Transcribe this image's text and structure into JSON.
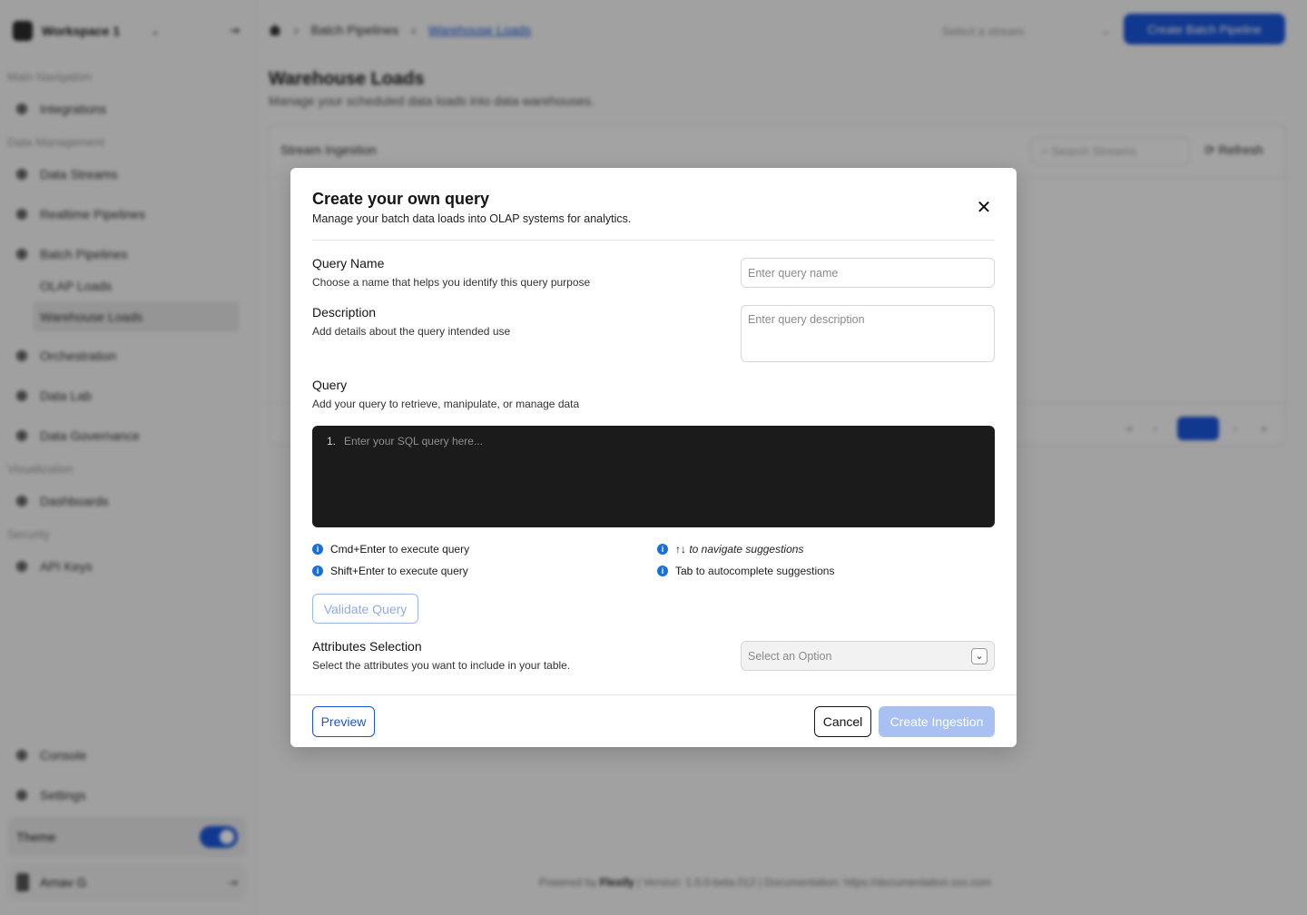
{
  "app": {
    "workspace": "Workspace 1",
    "sections": [
      "Main Navigation",
      "Data Management",
      "Visualization",
      "Security"
    ],
    "nav": {
      "integrations": "Integrations",
      "data_streams": "Data Streams",
      "realtime_pipelines": "Realtime Pipelines",
      "batch_pipelines": "Batch Pipelines",
      "olap_loads": "OLAP Loads",
      "warehouse_loads": "Warehouse Loads",
      "orchestration": "Orchestration",
      "data_lab": "Data Lab",
      "data_governance": "Data Governance",
      "dashboards": "Dashboards",
      "api_keys": "API Keys",
      "console": "Console",
      "settings": "Settings"
    },
    "theme_label": "Theme",
    "user_name": "Arnav G",
    "breadcrumb": {
      "section": "Batch Pipelines",
      "current": "Warehouse Loads"
    },
    "stream_select_placeholder": "Select a stream",
    "new_button": "Create Batch Pipeline",
    "page_title": "Warehouse Loads",
    "page_subtitle": "Manage your scheduled data loads into data warehouses.",
    "card_title": "Stream Ingestion",
    "search_placeholder": "Search Streams",
    "refresh_label": "Refresh",
    "footer": {
      "powered_by": "Powered by",
      "brand": "Flexify",
      "version": "Version: 1.0.0-beta.012",
      "docs": "Documentation: https://documentation.xxx.com"
    }
  },
  "modal": {
    "title": "Create your own query",
    "subtitle": "Manage your batch data loads into OLAP systems for analytics.",
    "query_name": {
      "label": "Query Name",
      "help": "Choose a name that helps you identify this query purpose",
      "placeholder": "Enter query name",
      "value": ""
    },
    "description": {
      "label": "Description",
      "help": "Add details about the query intended use",
      "placeholder": "Enter query description",
      "value": ""
    },
    "query": {
      "label": "Query",
      "help": "Add your query to retrieve, manipulate, or manage data",
      "line_number": "1.",
      "placeholder": "Enter your SQL query here..."
    },
    "tips": [
      {
        "key": "Cmd+Enter",
        "text": "to execute query"
      },
      {
        "key": "↑↓",
        "text": "to navigate suggestions"
      },
      {
        "key": "Shift+Enter",
        "text": "to execute query"
      },
      {
        "key": "Tab",
        "text": "to autocomplete suggestions"
      }
    ],
    "validate_button": "Validate Query",
    "attributes": {
      "label": "Attributes Selection",
      "help": "Select the attributes you want to include in your table.",
      "select_placeholder": "Select an Option"
    },
    "preview_button": "Preview",
    "cancel_button": "Cancel",
    "create_button": "Create Ingestion"
  },
  "colors": {
    "accent": "#1a55d9",
    "accent_disabled": "#a8c1f2",
    "editor_bg": "#1b1b1b",
    "info": "#1a6fd9"
  }
}
